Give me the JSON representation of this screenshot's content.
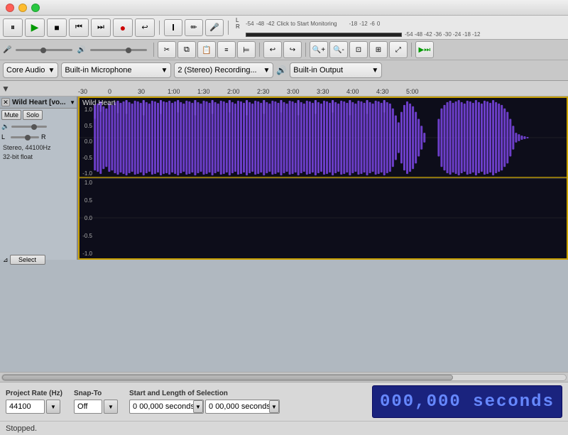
{
  "titlebar": {},
  "toolbar1": {
    "buttons": [
      "pause",
      "play",
      "stop",
      "skip-back",
      "skip-forward",
      "record",
      "loop"
    ],
    "pause_label": "⏸",
    "play_label": "▶",
    "stop_label": "■",
    "skip_back_label": "⏮",
    "skip_fwd_label": "⏭",
    "record_label": "●",
    "loop_label": "↩"
  },
  "tools": {
    "select_label": "I",
    "draw_label": "✏",
    "mic_label": "🎤",
    "scissors_label": "✂",
    "copy_label": "⧉",
    "zoom_label": "🔍"
  },
  "meter": {
    "lr_label": "LR",
    "db_markers": [
      "-54",
      "-48",
      "-42",
      "Click to Start Monitoring",
      "-18",
      "-12",
      "-6",
      "0"
    ],
    "db_markers2": [
      "-54",
      "-48",
      "-42",
      "-36",
      "-30",
      "-24",
      "-18",
      "-12"
    ]
  },
  "devices": {
    "audio_host": "Core Audio",
    "input_device": "Built-in Microphone",
    "channels": "2 (Stereo) Recording...",
    "output_device": "Built-in Output"
  },
  "timeline": {
    "markers": [
      "-30",
      "0",
      "30",
      "1:00",
      "1:30",
      "2:00",
      "2:30",
      "3:00",
      "3:30",
      "4:00",
      "4:30",
      "5:00"
    ]
  },
  "track": {
    "name": "Wild Heart",
    "name_abbreviated": "Wild Heart [vo...",
    "mute_label": "Mute",
    "solo_label": "Solo",
    "info": "Stereo, 44100Hz\n32-bit float",
    "select_label": "Select",
    "y_labels_top": [
      "1.0",
      "0.5",
      "0.0",
      "-0.5",
      "-1.0"
    ],
    "y_labels_bottom": [
      "1.0",
      "0.5",
      "0.0",
      "-0.5",
      "-1.0"
    ],
    "waveform_color": "#6633cc",
    "border_color": "#c8a000"
  },
  "bottom": {
    "project_rate_label": "Project Rate (Hz)",
    "project_rate_value": "44100",
    "snap_to_label": "Snap-To",
    "snap_to_value": "Off",
    "selection_label": "Start and Length of Selection",
    "sel_input1": "0 00,000 seconds",
    "sel_input2": "0 00,000 seconds",
    "sel_dropdown_label": "▼",
    "time_display": "000,000 seconds",
    "status": "Stopped."
  },
  "gain_row": {
    "mic_icon": "🎤",
    "speaker_icon": "🔊"
  }
}
